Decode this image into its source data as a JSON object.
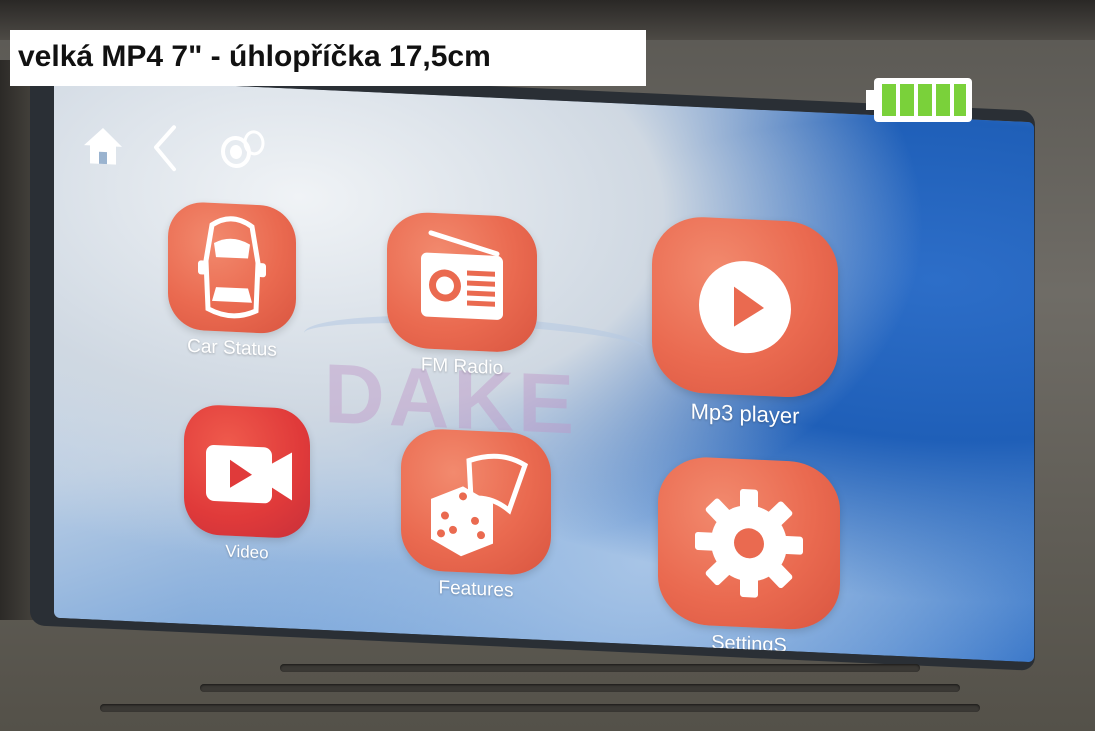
{
  "caption": {
    "text": "velká MP4 7\" - úhlopříčka 17,5cm"
  },
  "topbar": {
    "icons": [
      "home-icon",
      "back-icon",
      "volume-icon"
    ]
  },
  "status": {
    "battery_icon": "battery-icon",
    "battery_level": 1.0,
    "battery_color": "#7ad13a"
  },
  "background": {
    "watermark": "DAKE"
  },
  "apps": [
    {
      "label": "Car Status",
      "icon": "car-icon"
    },
    {
      "label": "FM Radio",
      "icon": "radio-icon"
    },
    {
      "label": "Mp3 player",
      "icon": "play-icon"
    },
    {
      "label": "Video",
      "icon": "video-camera-icon"
    },
    {
      "label": "Features",
      "icon": "dice-icon"
    },
    {
      "label": "SettingS",
      "icon": "gear-icon"
    }
  ],
  "colors": {
    "tile": "#ea6a50",
    "tile_dark": "#e03a3a",
    "label": "#ffffff"
  }
}
